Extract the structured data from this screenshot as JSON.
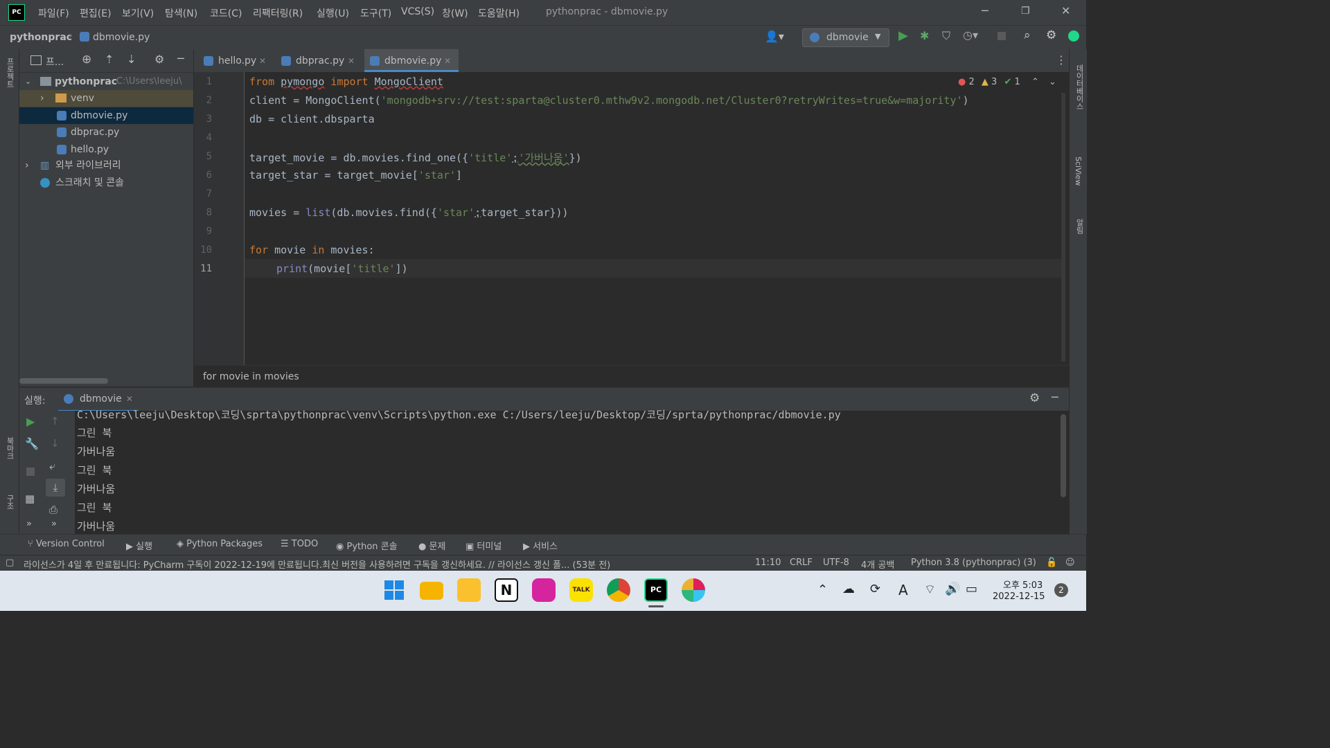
{
  "title_bar": {
    "menus": [
      "파일(F)",
      "편집(E)",
      "보기(V)",
      "탐색(N)",
      "코드(C)",
      "리팩터링(R)",
      "실행(U)",
      "도구(T)",
      "VCS(S)",
      "창(W)",
      "도움말(H)"
    ],
    "window_title": "pythonprac - dbmovie.py"
  },
  "nav": {
    "project": "pythonprac",
    "file": "dbmovie.py",
    "run_config": "dbmovie"
  },
  "project_panel": {
    "header": "프...",
    "root_name": "pythonprac",
    "root_path": "C:\\Users\\leeju\\",
    "items": [
      "venv",
      "dbmovie.py",
      "dbprac.py",
      "hello.py"
    ],
    "external_libs": "외부 라이브러리",
    "scratches": "스크래치 및 콘솔"
  },
  "tabs": [
    "hello.py",
    "dbprac.py",
    "dbmovie.py"
  ],
  "inspections": {
    "errors": "2",
    "warnings": "3",
    "ok": "1"
  },
  "code": {
    "line_numbers": [
      "1",
      "2",
      "3",
      "4",
      "5",
      "6",
      "7",
      "8",
      "9",
      "10",
      "11"
    ],
    "l1": {
      "kw1": "from",
      "mod": "pymongo",
      "kw2": "import",
      "cls": "MongoClient"
    },
    "l2": {
      "pre": "client = MongoClient(",
      "str": "'mongodb+srv://test:sparta@cluster0.mthw9v2.mongodb.net/Cluster0?retryWrites=true&w=majority'",
      "post": ")"
    },
    "l3": "db = client.dbsparta",
    "l5": {
      "pre": "target_movie = db.movies.find_one({",
      "k": "'title'",
      "colon": ":",
      "v": "'가버나움'",
      "post": "})"
    },
    "l6": {
      "pre": "target_star = target_movie[",
      "k": "'star'",
      "post": "]"
    },
    "l8": {
      "pre": "movies = ",
      "fn": "list",
      "mid": "(db.movies.find({",
      "k": "'star'",
      "colon": ":",
      "post": "target_star}))"
    },
    "l10": {
      "kw1": "for",
      "v1": " movie ",
      "kw2": "in",
      "v2": " movies:"
    },
    "l11": {
      "fn": "print",
      "mid": "(movie[",
      "k": "'title'",
      "post": "])"
    }
  },
  "breadcrumb": "for movie in movies",
  "run": {
    "label": "실행:",
    "tab": "dbmovie",
    "output": [
      "C:\\Users\\leeju\\Desktop\\코딩\\sprta\\pythonprac\\venv\\Scripts\\python.exe C:/Users/leeju/Desktop/코딩/sprta/pythonprac/dbmovie.py",
      "그린 북",
      "가버나움",
      "그린 북",
      "가버나움",
      "그린 북",
      "가버나움"
    ]
  },
  "bottom_tools": [
    "Version Control",
    "실행",
    "Python Packages",
    "TODO",
    "Python 콘솔",
    "문제",
    "터미널",
    "서비스"
  ],
  "status": {
    "message": "라이선스가 4일 후 만료됩니다: PyCharm 구독이 2022-12-19에 만료됩니다.최신 버전을 사용하려면 구독을 갱신하세요. // 라이선스 갱신   폴... (53분 전)",
    "position": "11:10",
    "line_sep": "CRLF",
    "encoding": "UTF-8",
    "indent": "4개 공백",
    "interpreter": "Python 3.8 (pythonprac) (3)"
  },
  "left_strip": {
    "project": "프로젝트",
    "bookmarks": "북마크",
    "structure": "구조"
  },
  "right_strip": {
    "db": "데이터베이스",
    "sciview": "SciView",
    "notif": "알림"
  },
  "taskbar": {
    "time": "오후 5:03",
    "date": "2022-12-15",
    "notif_count": "2",
    "ime": "A",
    "colors": {
      "windows": "#1e88e5",
      "files": "#f4b400",
      "notes": "#fbc02d",
      "notion": "#ffffff",
      "instagram": "#d6249f",
      "kakao": "#fae100",
      "chrome": "#4caf50",
      "pycharm": "#21d789",
      "slack": "#e01e5a"
    }
  }
}
